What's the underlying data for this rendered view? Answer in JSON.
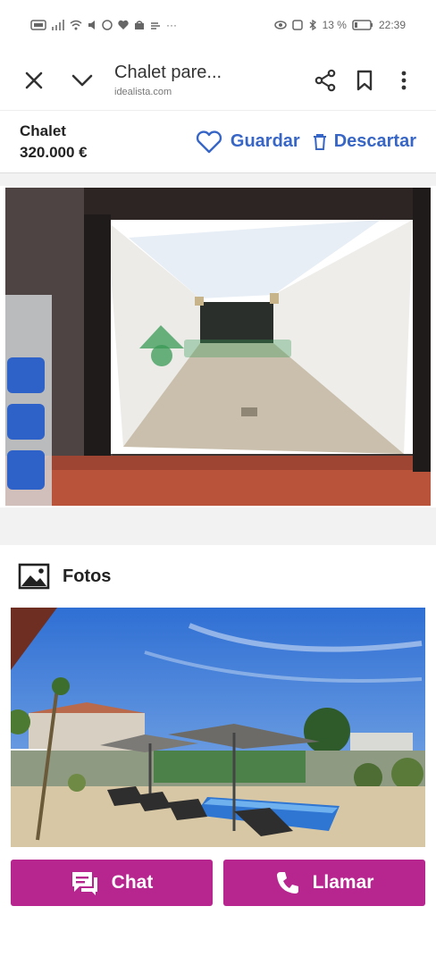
{
  "status_bar": {
    "left_icons": [
      "sim-icon",
      "signal-icon",
      "wifi-icon",
      "volume-icon",
      "whatsapp-icon",
      "heart-icon",
      "shop-icon",
      "wind-icon",
      "more-icon"
    ],
    "battery": "13 %",
    "time": "22:39"
  },
  "toolbar": {
    "title": "Chalet pare...",
    "url": "idealista.com"
  },
  "listing": {
    "type": "Chalet",
    "price": "320.000 €",
    "save_label": "Guardar",
    "discard_label": "Descartar"
  },
  "photos_section": {
    "label": "Fotos"
  },
  "actions": {
    "chat_label": "Chat",
    "call_label": "Llamar"
  },
  "colors": {
    "accent_blue": "#3866c6",
    "cta_magenta": "#b7268f"
  }
}
